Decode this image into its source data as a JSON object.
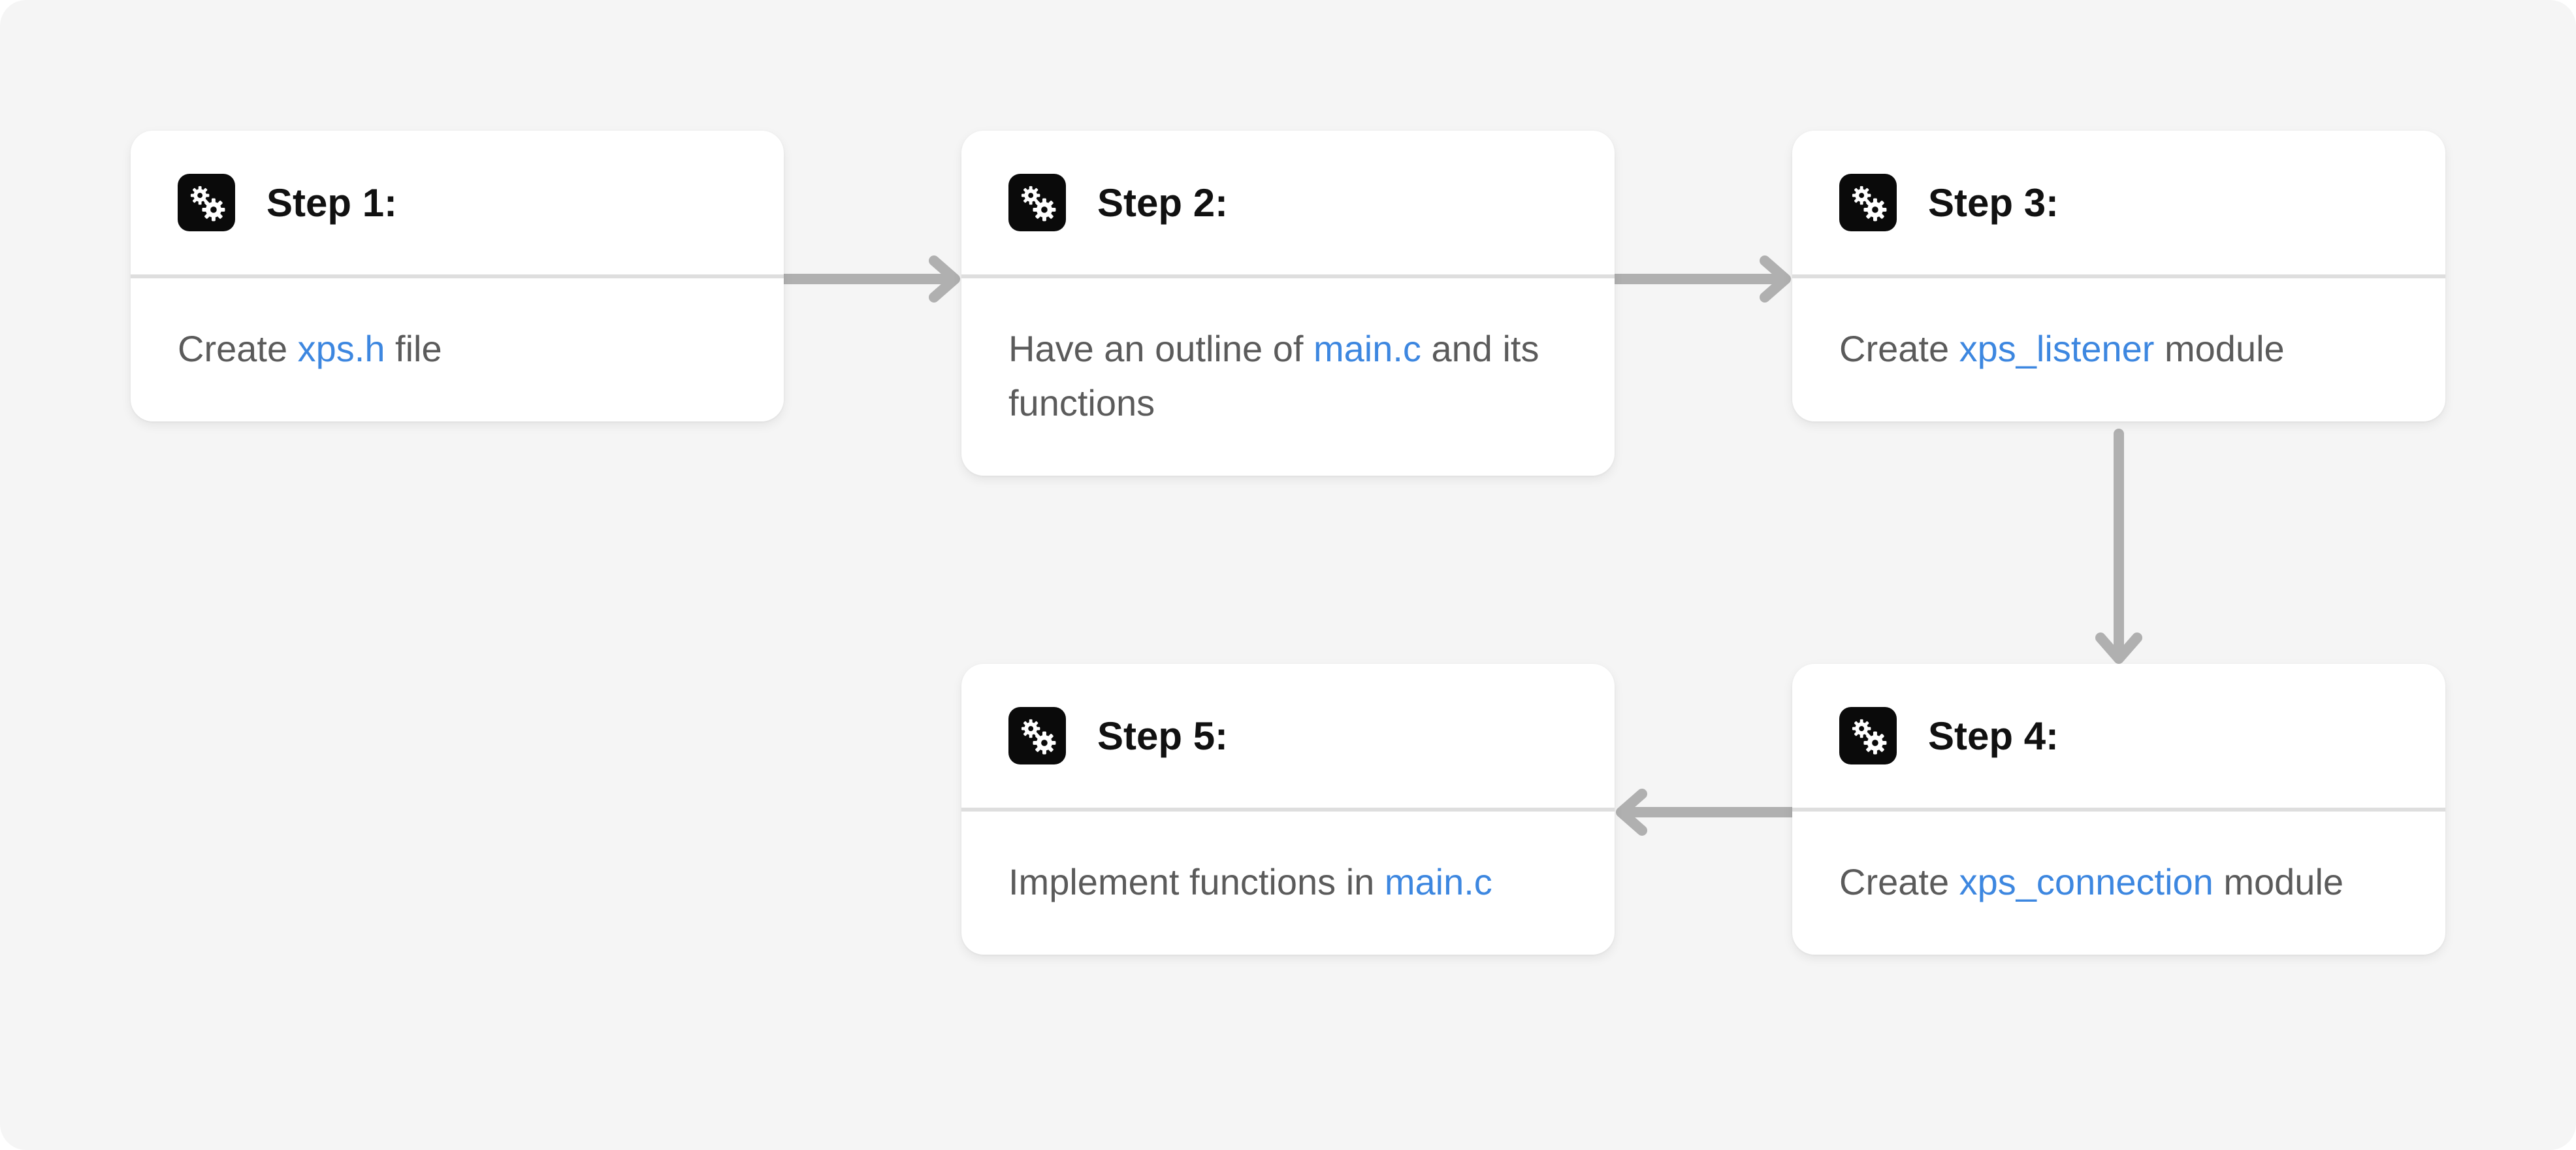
{
  "colors": {
    "background": "#f5f5f5",
    "card": "#ffffff",
    "divider": "#dedede",
    "connector": "#b0b0b0",
    "highlight": "#3d87e0",
    "text": "#5b5b5b",
    "title": "#111111",
    "icon_bg": "#0a0a0a"
  },
  "steps": [
    {
      "icon": "gears-icon",
      "title": "Step 1:",
      "pre": "Create ",
      "hl": "xps.h",
      "post": " file"
    },
    {
      "icon": "gears-icon",
      "title": "Step 2:",
      "pre": "Have an outline of ",
      "hl": "main.c",
      "post": " and its functions"
    },
    {
      "icon": "gears-icon",
      "title": "Step 3:",
      "pre": "Create ",
      "hl": "xps_listener",
      "post": " module"
    },
    {
      "icon": "gears-icon",
      "title": "Step 4:",
      "pre": "Create ",
      "hl": "xps_connection",
      "post": " module"
    },
    {
      "icon": "gears-icon",
      "title": "Step 5:",
      "pre": "Implement functions in ",
      "hl": "main.c",
      "post": ""
    }
  ],
  "flow": [
    {
      "from": "Step 1:",
      "to": "Step 2:"
    },
    {
      "from": "Step 2:",
      "to": "Step 3:"
    },
    {
      "from": "Step 3:",
      "to": "Step 4:"
    },
    {
      "from": "Step 4:",
      "to": "Step 5:"
    }
  ]
}
